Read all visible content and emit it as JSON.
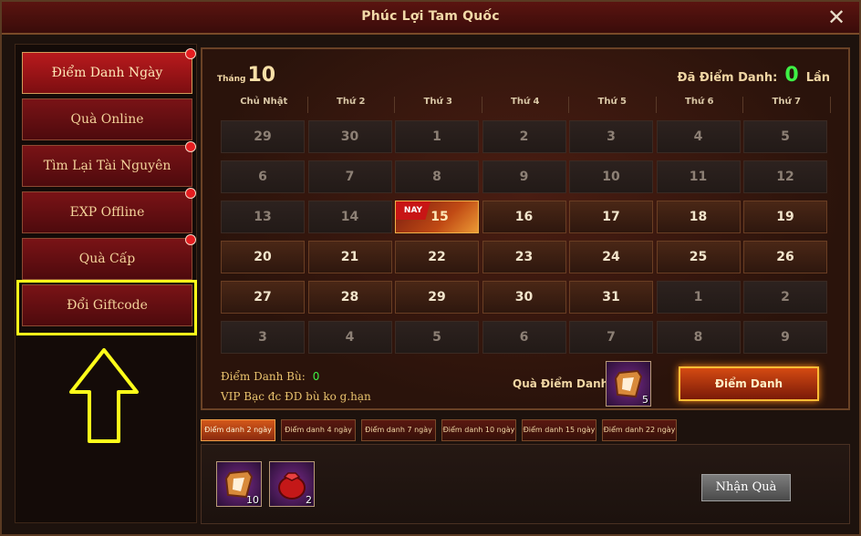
{
  "window": {
    "title": "Phúc Lợi Tam Quốc",
    "close_label": "✕"
  },
  "sidebar": {
    "items": [
      {
        "label": "Điểm Danh Ngày",
        "active": true,
        "dot": true
      },
      {
        "label": "Quà Online",
        "active": false,
        "dot": false
      },
      {
        "label": "Tìm Lại Tài Nguyên",
        "active": false,
        "dot": true
      },
      {
        "label": "EXP Offline",
        "active": false,
        "dot": true
      },
      {
        "label": "Quà Cấp",
        "active": false,
        "dot": true
      },
      {
        "label": "Đổi Giftcode",
        "active": false,
        "dot": false
      }
    ]
  },
  "calendar": {
    "month_label": "Tháng",
    "month": "10",
    "checked_label": "Đã Điểm Danh:",
    "checked_count": "0",
    "checked_unit": "Lần",
    "weekdays": [
      "Chủ Nhật",
      "Thứ 2",
      "Thứ 3",
      "Thứ 4",
      "Thứ 5",
      "Thứ 6",
      "Thứ 7"
    ],
    "today_badge": "NAY",
    "weeks": [
      [
        [
          "29",
          "muted"
        ],
        [
          "30",
          "muted"
        ],
        [
          "1",
          "muted"
        ],
        [
          "2",
          "muted"
        ],
        [
          "3",
          "muted"
        ],
        [
          "4",
          "muted"
        ],
        [
          "5",
          "muted"
        ]
      ],
      [
        [
          "6",
          "muted"
        ],
        [
          "7",
          "muted"
        ],
        [
          "8",
          "muted"
        ],
        [
          "9",
          "muted"
        ],
        [
          "10",
          "muted"
        ],
        [
          "11",
          "muted"
        ],
        [
          "12",
          "muted"
        ]
      ],
      [
        [
          "13",
          "muted"
        ],
        [
          "14",
          "muted"
        ],
        [
          "15",
          "today"
        ],
        [
          "16",
          "future"
        ],
        [
          "17",
          "future"
        ],
        [
          "18",
          "future"
        ],
        [
          "19",
          "future"
        ]
      ],
      [
        [
          "20",
          "future"
        ],
        [
          "21",
          "future"
        ],
        [
          "22",
          "future"
        ],
        [
          "23",
          "future"
        ],
        [
          "24",
          "future"
        ],
        [
          "25",
          "future"
        ],
        [
          "26",
          "future"
        ]
      ],
      [
        [
          "27",
          "future"
        ],
        [
          "28",
          "future"
        ],
        [
          "29",
          "future"
        ],
        [
          "30",
          "future"
        ],
        [
          "31",
          "future"
        ],
        [
          "1",
          "muted"
        ],
        [
          "2",
          "muted"
        ]
      ],
      [
        [
          "3",
          "muted"
        ],
        [
          "4",
          "muted"
        ],
        [
          "5",
          "muted"
        ],
        [
          "6",
          "muted"
        ],
        [
          "7",
          "muted"
        ],
        [
          "8",
          "muted"
        ],
        [
          "9",
          "muted"
        ]
      ]
    ],
    "bu_label": "Điểm Danh Bù:",
    "bu_value": "0",
    "vip_note": "VIP Bạc đc ĐD bù ko g.hạn",
    "reward_label": "Quà Điểm Danh:",
    "reward_count": "5",
    "checkin_button": "Điểm Danh"
  },
  "tabs": [
    "Điểm danh 2 ngày",
    "Điểm danh 4 ngày",
    "Điểm danh 7 ngày",
    "Điểm danh 10 ngày",
    "Điểm danh 15 ngày",
    "Điểm danh 22 ngày"
  ],
  "rewards": {
    "items": [
      {
        "icon": "scroll-icon",
        "count": "10"
      },
      {
        "icon": "red-pouch-icon",
        "count": "2"
      }
    ],
    "claim_button": "Nhận Quà"
  },
  "colors": {
    "highlight": "#ffff1a",
    "active_red": "#b81a1d",
    "green": "#3ef045"
  }
}
